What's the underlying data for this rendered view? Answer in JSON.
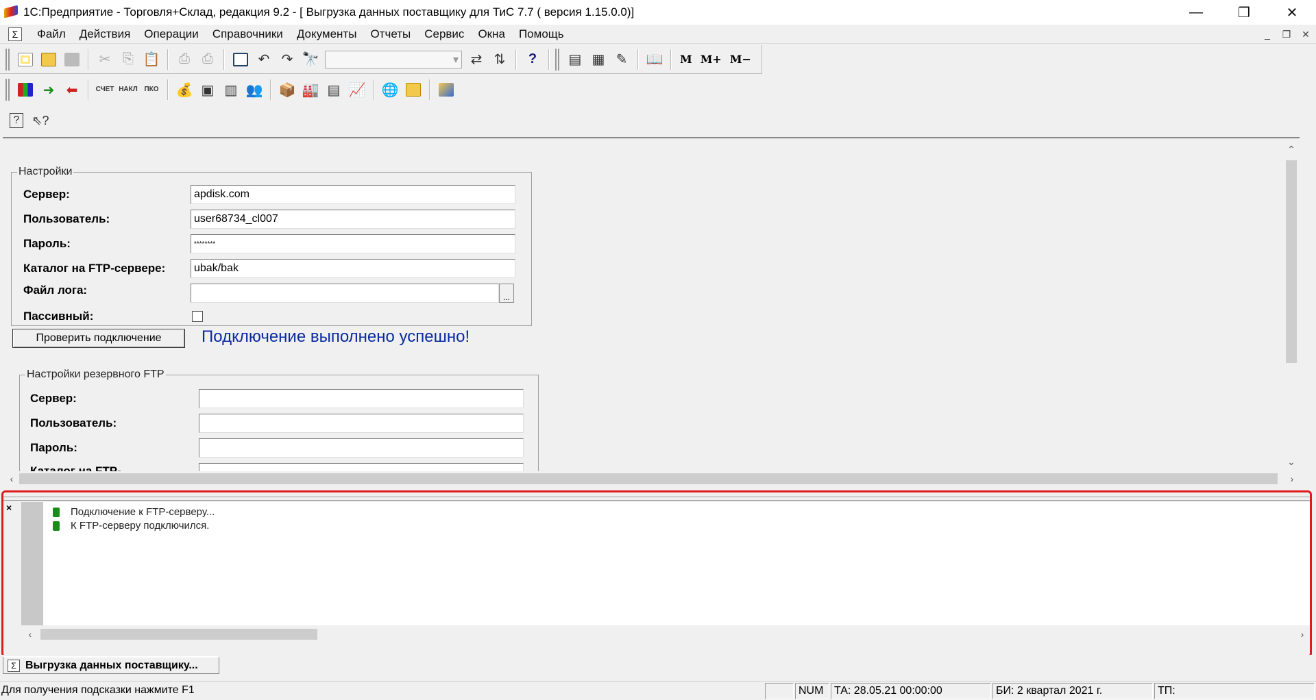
{
  "window": {
    "title": "1С:Предприятие - Торговля+Склад, редакция 9.2 - [ Выгрузка данных поставщику для ТиС 7.7 ( версия 1.15.0.0)]",
    "controls": [
      "—",
      "❐",
      "✕"
    ]
  },
  "menu": {
    "items": [
      "Файл",
      "Действия",
      "Операции",
      "Справочники",
      "Документы",
      "Отчеты",
      "Сервис",
      "Окна",
      "Помощь"
    ]
  },
  "toolbar": {
    "m_label": "M",
    "mplus_label": "M+",
    "mminus_label": "M−",
    "doc_icons": [
      "СЧЕТ",
      "НАКЛ",
      "ПКО"
    ]
  },
  "settings": {
    "legend": "Настройки",
    "server_label": "Сервер:",
    "server_value": "apdisk.com",
    "user_label": "Пользователь:",
    "user_value": "user68734_cl007",
    "password_label": "Пароль:",
    "password_value": "********",
    "catalog_label": "Каталог на FTP-сервере:",
    "catalog_value": "ubak/bak",
    "logfile_label": "Файл лога:",
    "logfile_value": "",
    "browse_label": "...",
    "passive_label": "Пассивный:",
    "passive_checked": false
  },
  "check_button": {
    "label": "Проверить подключение"
  },
  "connection_status": "Подключение выполнено успешно!",
  "backup": {
    "legend": "Настройки резервного FTP",
    "server_label": "Сервер:",
    "server_value": "",
    "user_label": "Пользователь:",
    "user_value": "",
    "password_label": "Пароль:",
    "password_value": "",
    "catalog_label": "Каталог на FTP-",
    "catalog_value": ""
  },
  "messages": {
    "lines": [
      "Подключение к FTP-серверу...",
      "К FTP-серверу подключился."
    ],
    "close_glyph": "×"
  },
  "task_tab": {
    "label": "Выгрузка данных поставщику..."
  },
  "statusbar": {
    "hint": "Для получения подсказки нажмите F1",
    "num": "NUM",
    "ta": "ТА: 28.05.21  00:00:00",
    "bi": "БИ: 2 квартал 2021 г.",
    "tp": "ТП:"
  }
}
